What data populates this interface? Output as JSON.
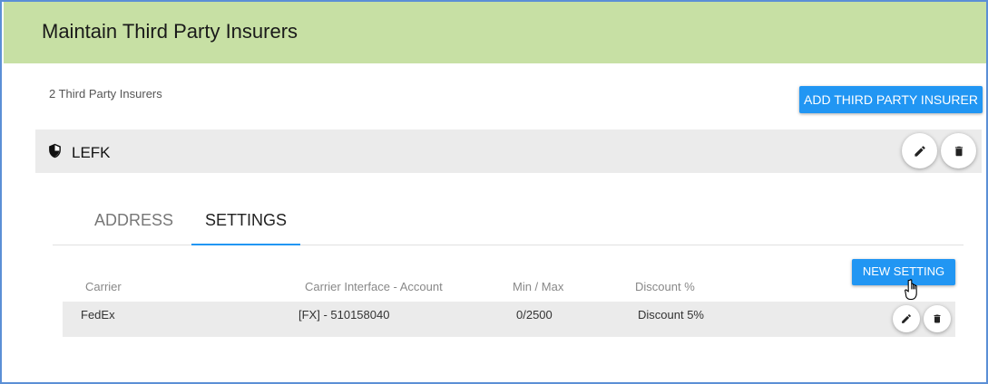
{
  "header": {
    "title": "Maintain Third Party Insurers"
  },
  "summary": {
    "count_text": "2 Third Party Insurers"
  },
  "actions": {
    "add_label": "ADD THIRD PARTY INSURER",
    "new_setting_label": "NEW SETTING"
  },
  "insurer": {
    "name": "LEFK",
    "icon": "shield-icon"
  },
  "tabs": [
    {
      "label": "ADDRESS",
      "active": false
    },
    {
      "label": "SETTINGS",
      "active": true
    }
  ],
  "settings_table": {
    "columns": [
      "Carrier",
      "Carrier Interface - Account",
      "Min / Max",
      "Discount %"
    ],
    "rows": [
      {
        "carrier": "FedEx",
        "account": "[FX] - 510158040",
        "min_max": "0/2500",
        "discount": "Discount 5%"
      }
    ]
  },
  "colors": {
    "header_bg": "#c7e0a4",
    "primary": "#2196f3",
    "row_bg": "#ebebeb",
    "frame_border": "#5b8fd6"
  }
}
